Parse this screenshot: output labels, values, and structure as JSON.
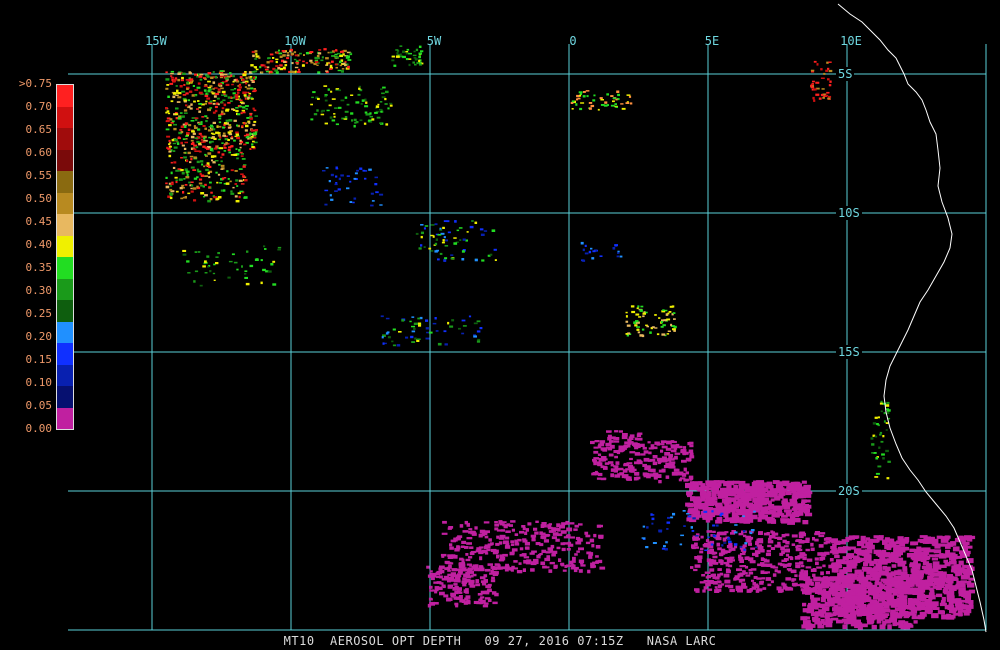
{
  "footer": {
    "product": "MT10",
    "parameter": "AEROSOL OPT DEPTH",
    "date": "09 27, 2016",
    "time": "07:15Z",
    "source": "NASA LARC"
  },
  "longitude_labels": [
    "15W",
    "10W",
    "5W",
    "0",
    "5E",
    "10E"
  ],
  "latitude_labels": [
    "5S",
    "10S",
    "15S",
    "20S"
  ],
  "legend": {
    "labels": [
      ">0.75",
      "0.70",
      "0.65",
      "0.60",
      "0.55",
      "0.50",
      "0.45",
      "0.40",
      "0.35",
      "0.30",
      "0.25",
      "0.20",
      "0.15",
      "0.10",
      "0.05",
      "0.00"
    ],
    "colors": [
      "#ff2020",
      "#d01010",
      "#a00c0c",
      "#7a0a0a",
      "#8a6a10",
      "#b88a20",
      "#e8b860",
      "#f0f000",
      "#22dd22",
      "#1a9a1a",
      "#0e5e0e",
      "#2090ff",
      "#1030ff",
      "#0820b0",
      "#061070",
      "#c020a0"
    ]
  },
  "colors": {
    "grid": "#5ad0d8",
    "coast": "#ffffff",
    "low_aod": "#c020a0"
  }
}
